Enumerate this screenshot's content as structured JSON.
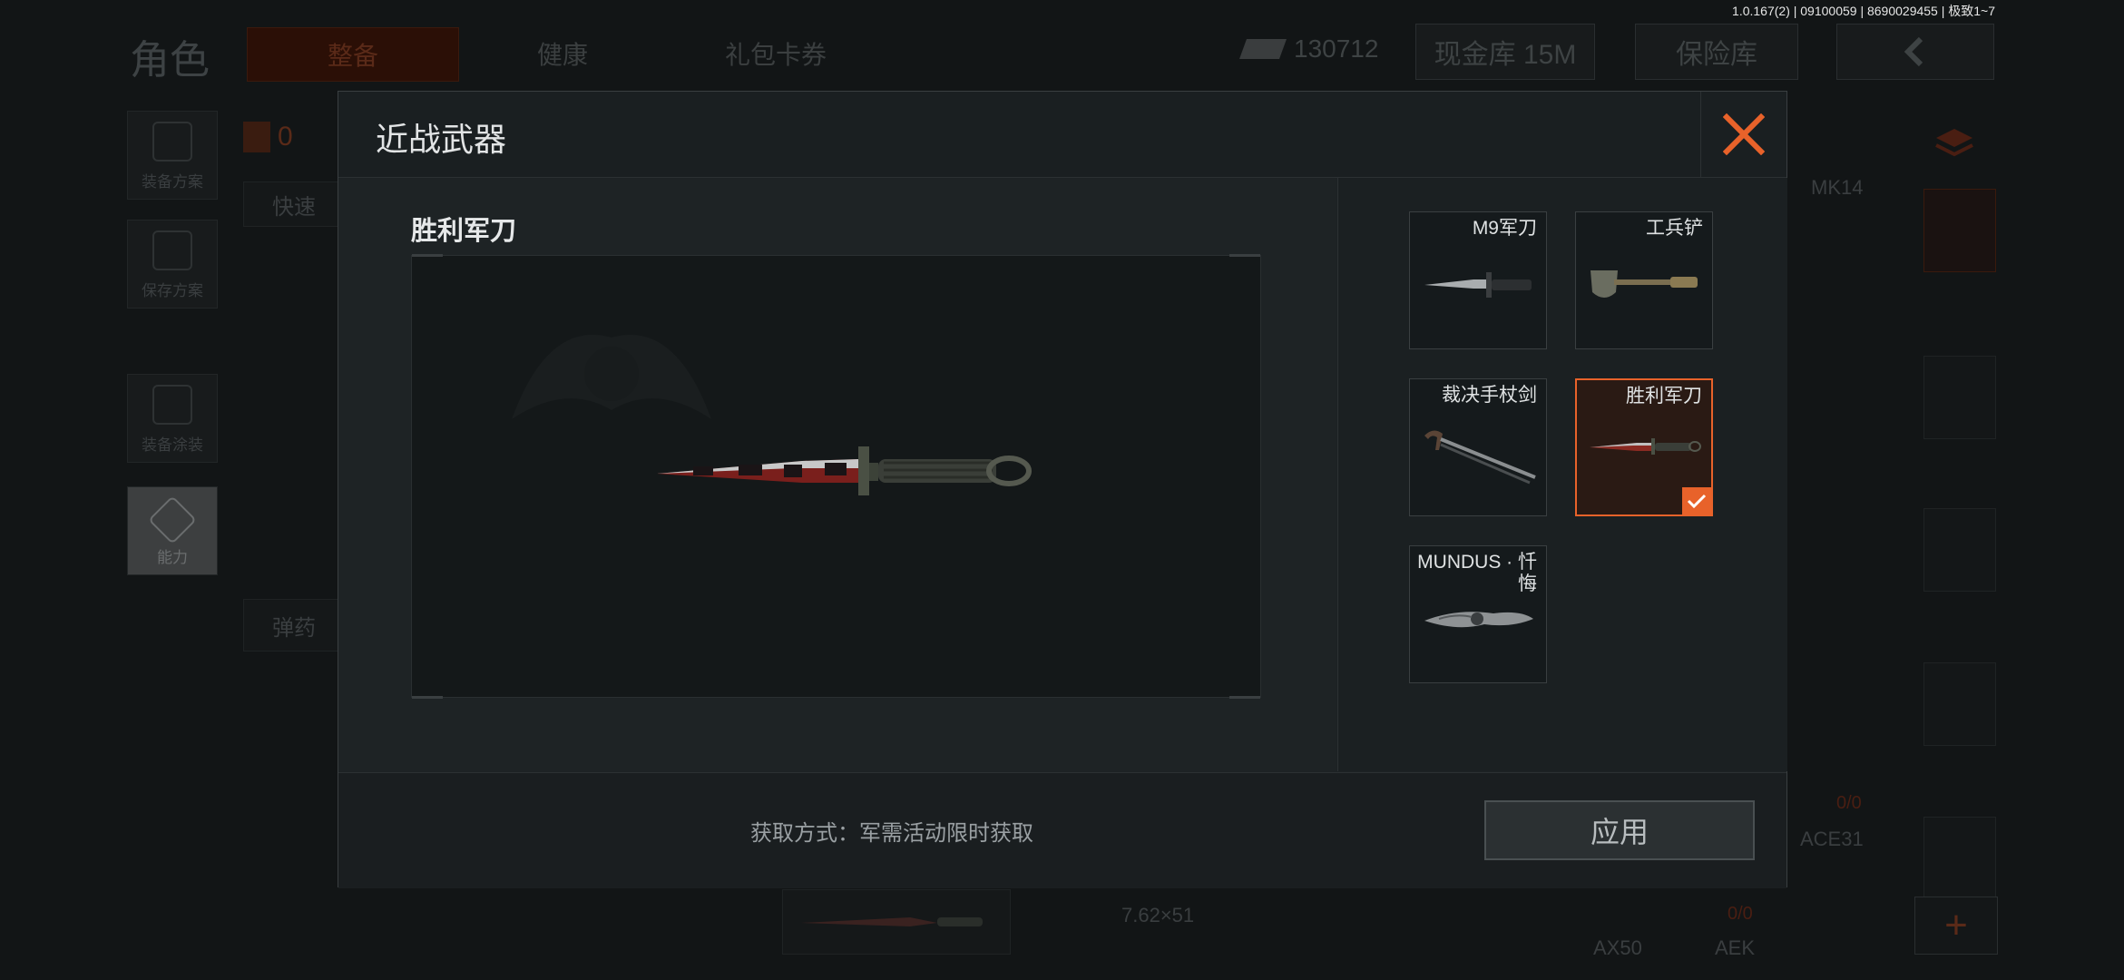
{
  "version": "1.0.167(2) | 09100059 | 8690029455 | 极致1~7",
  "background": {
    "title": "角色",
    "tabs": [
      "整备",
      "健康",
      "礼包卡券"
    ],
    "cash": "130712",
    "cash_store": "现金库 15M",
    "insurance": "保险库",
    "side_buttons": [
      "装备方案",
      "保存方案",
      "装备涂装",
      "能力"
    ],
    "vest_count": "0",
    "quick_label": "快速",
    "ammo_label": "弹药",
    "weapon_labels": [
      "MK14",
      "ACE31",
      "AX50",
      "AEK"
    ],
    "caliber": "7.62×51",
    "ammo_counts": [
      "0/0",
      "0/0"
    ]
  },
  "modal": {
    "title": "近战武器",
    "selected_name": "胜利军刀",
    "acquire_text": "获取方式：军需活动限时获取",
    "apply_label": "应用",
    "items": [
      {
        "name": "M9军刀",
        "icon": "bayonet-icon",
        "selected": false
      },
      {
        "name": "工兵铲",
        "icon": "shovel-icon",
        "selected": false
      },
      {
        "name": "裁决手杖剑",
        "icon": "cane-sword-icon",
        "selected": false
      },
      {
        "name": "胜利军刀",
        "icon": "victory-knife-icon",
        "selected": true
      },
      {
        "name": "MUNDUS · 忏悔",
        "icon": "karambit-icon",
        "selected": false
      }
    ]
  },
  "colors": {
    "accent": "#e8622a",
    "modal_bg": "#1d2224",
    "overlay_dim": "#0d0f10"
  }
}
